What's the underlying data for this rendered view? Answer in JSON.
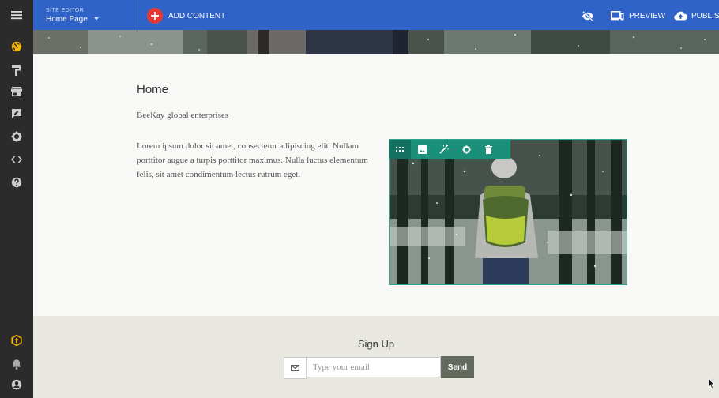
{
  "topbar": {
    "site_editor_label": "SITE EDITOR",
    "page_name": "Home Page",
    "add_content_label": "ADD CONTENT",
    "preview_label": "PREVIEW",
    "publish_label": "PUBLISH"
  },
  "sidebar": {
    "items": [
      {
        "icon": "globe-icon",
        "color": "#f2b705"
      },
      {
        "icon": "paint-roller-icon"
      },
      {
        "icon": "store-icon"
      },
      {
        "icon": "feedback-icon"
      },
      {
        "icon": "gear-icon"
      },
      {
        "icon": "code-icon"
      },
      {
        "icon": "help-icon"
      }
    ],
    "bottom": [
      {
        "icon": "upgrade-icon",
        "color": "#f2b705"
      },
      {
        "icon": "notifications-icon"
      },
      {
        "icon": "account-icon"
      }
    ]
  },
  "content": {
    "heading": "Home",
    "tagline": "BeeKay global enterprises",
    "paragraph": "Lorem ipsum dolor sit amet, consectetur adipiscing elit. Nullam porttitor augue a turpis porttitor maximus. Nulla luctus elementum felis, sit amet condimentum lectus rutrum eget."
  },
  "image_toolbar": {
    "tools": [
      "drag-handle-icon",
      "image-icon",
      "magic-wand-icon",
      "gear-icon",
      "trash-icon"
    ]
  },
  "footer": {
    "signup_title": "Sign Up",
    "email_placeholder": "Type your email",
    "send_label": "Send"
  },
  "colors": {
    "topbar": "#2f63c8",
    "accent_teal": "#1a8f7a",
    "add_button": "#e53935",
    "send_button": "#626a5e"
  }
}
